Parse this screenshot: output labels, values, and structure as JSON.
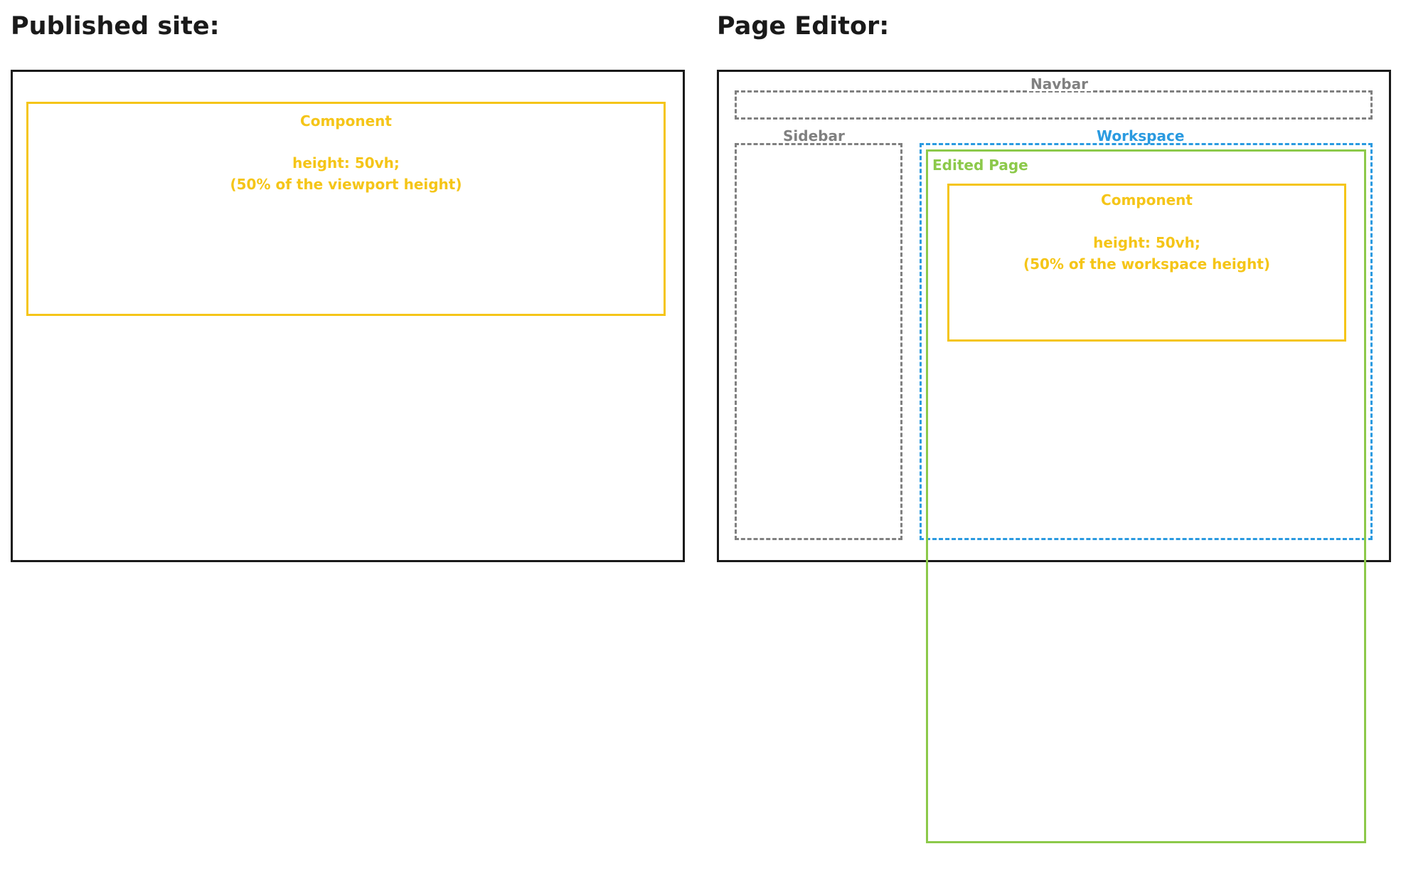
{
  "published": {
    "heading": "Published site:",
    "component": {
      "title": "Component",
      "css": "height: 50vh;",
      "note": "(50% of the viewport height)"
    }
  },
  "editor": {
    "heading": "Page Editor:",
    "navbar_label": "Navbar",
    "sidebar_label": "Sidebar",
    "workspace_label": "Workspace",
    "edited_page_label": "Edited Page",
    "component": {
      "title": "Component",
      "css": "height: 50vh;",
      "note": "(50% of the workspace height)"
    }
  },
  "colors": {
    "frame": "#1a1a1a",
    "component": "#f5c518",
    "chrome": "#808080",
    "workspace": "#2a9ae0",
    "edited_page": "#8cc94a"
  }
}
